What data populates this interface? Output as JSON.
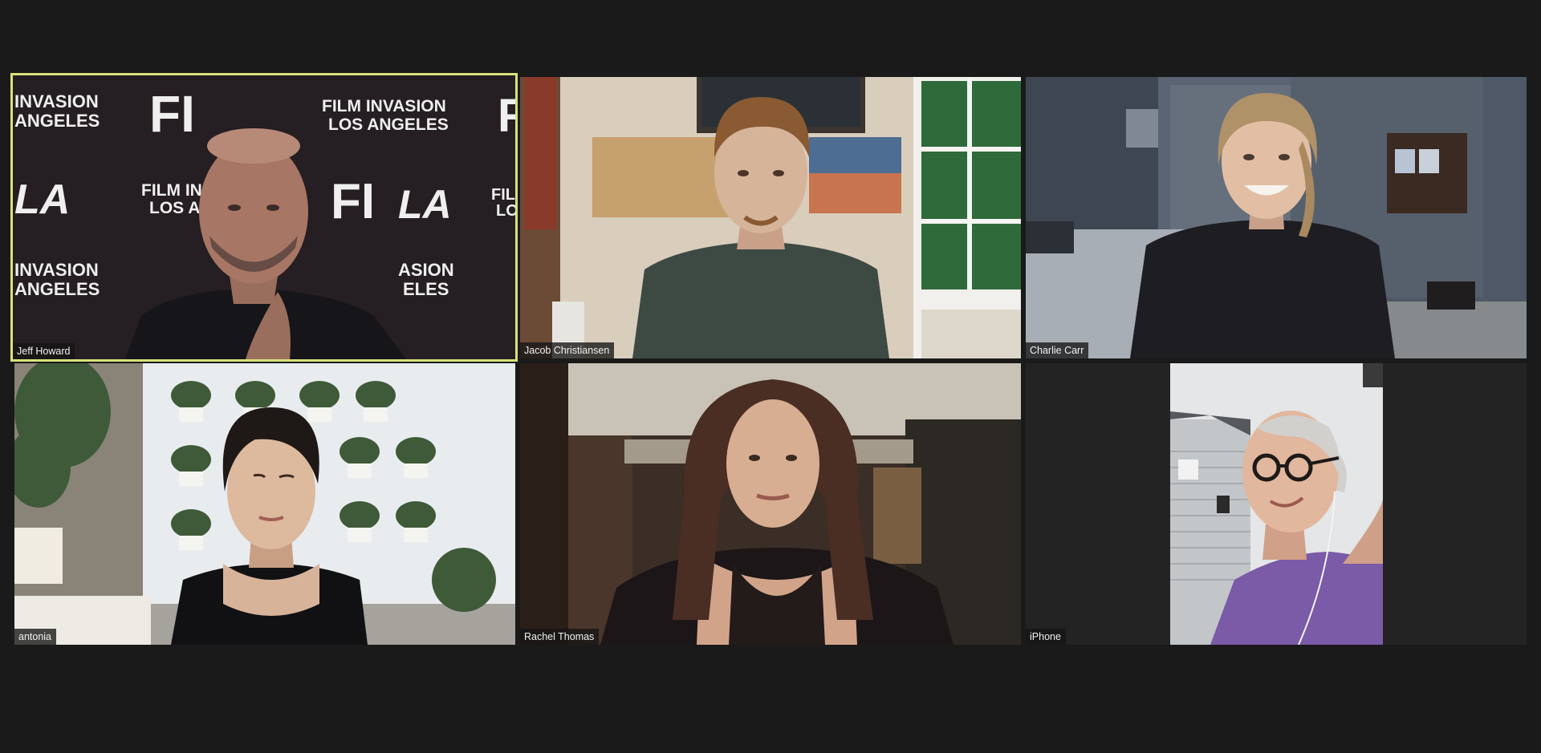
{
  "meeting": {
    "participants": [
      {
        "name": "Jeff Howard",
        "active_speaker": true
      },
      {
        "name": "Jacob Christiansen",
        "active_speaker": false
      },
      {
        "name": "Charlie Carr",
        "active_speaker": false
      },
      {
        "name": "antonia",
        "active_speaker": false
      },
      {
        "name": "Rachel Thomas",
        "active_speaker": false
      },
      {
        "name": "iPhone",
        "active_speaker": false
      }
    ],
    "backdrop_text": {
      "line1": "FILM INVASION",
      "line2": "LOS ANGELES",
      "logo_fi": "FI",
      "logo_la": "LA",
      "partial_left1": "INVASION",
      "partial_left2": "ANGELES",
      "partial_mid1": "FILM IN",
      "partial_mid2": "LOS ANGE",
      "partial_bot1": "ASION",
      "partial_bot2": "ELES"
    }
  },
  "colors": {
    "background": "#1a1a1a",
    "active_border": "#d7e27a",
    "label_bg": "#141414",
    "label_text": "#f1f1f1"
  }
}
